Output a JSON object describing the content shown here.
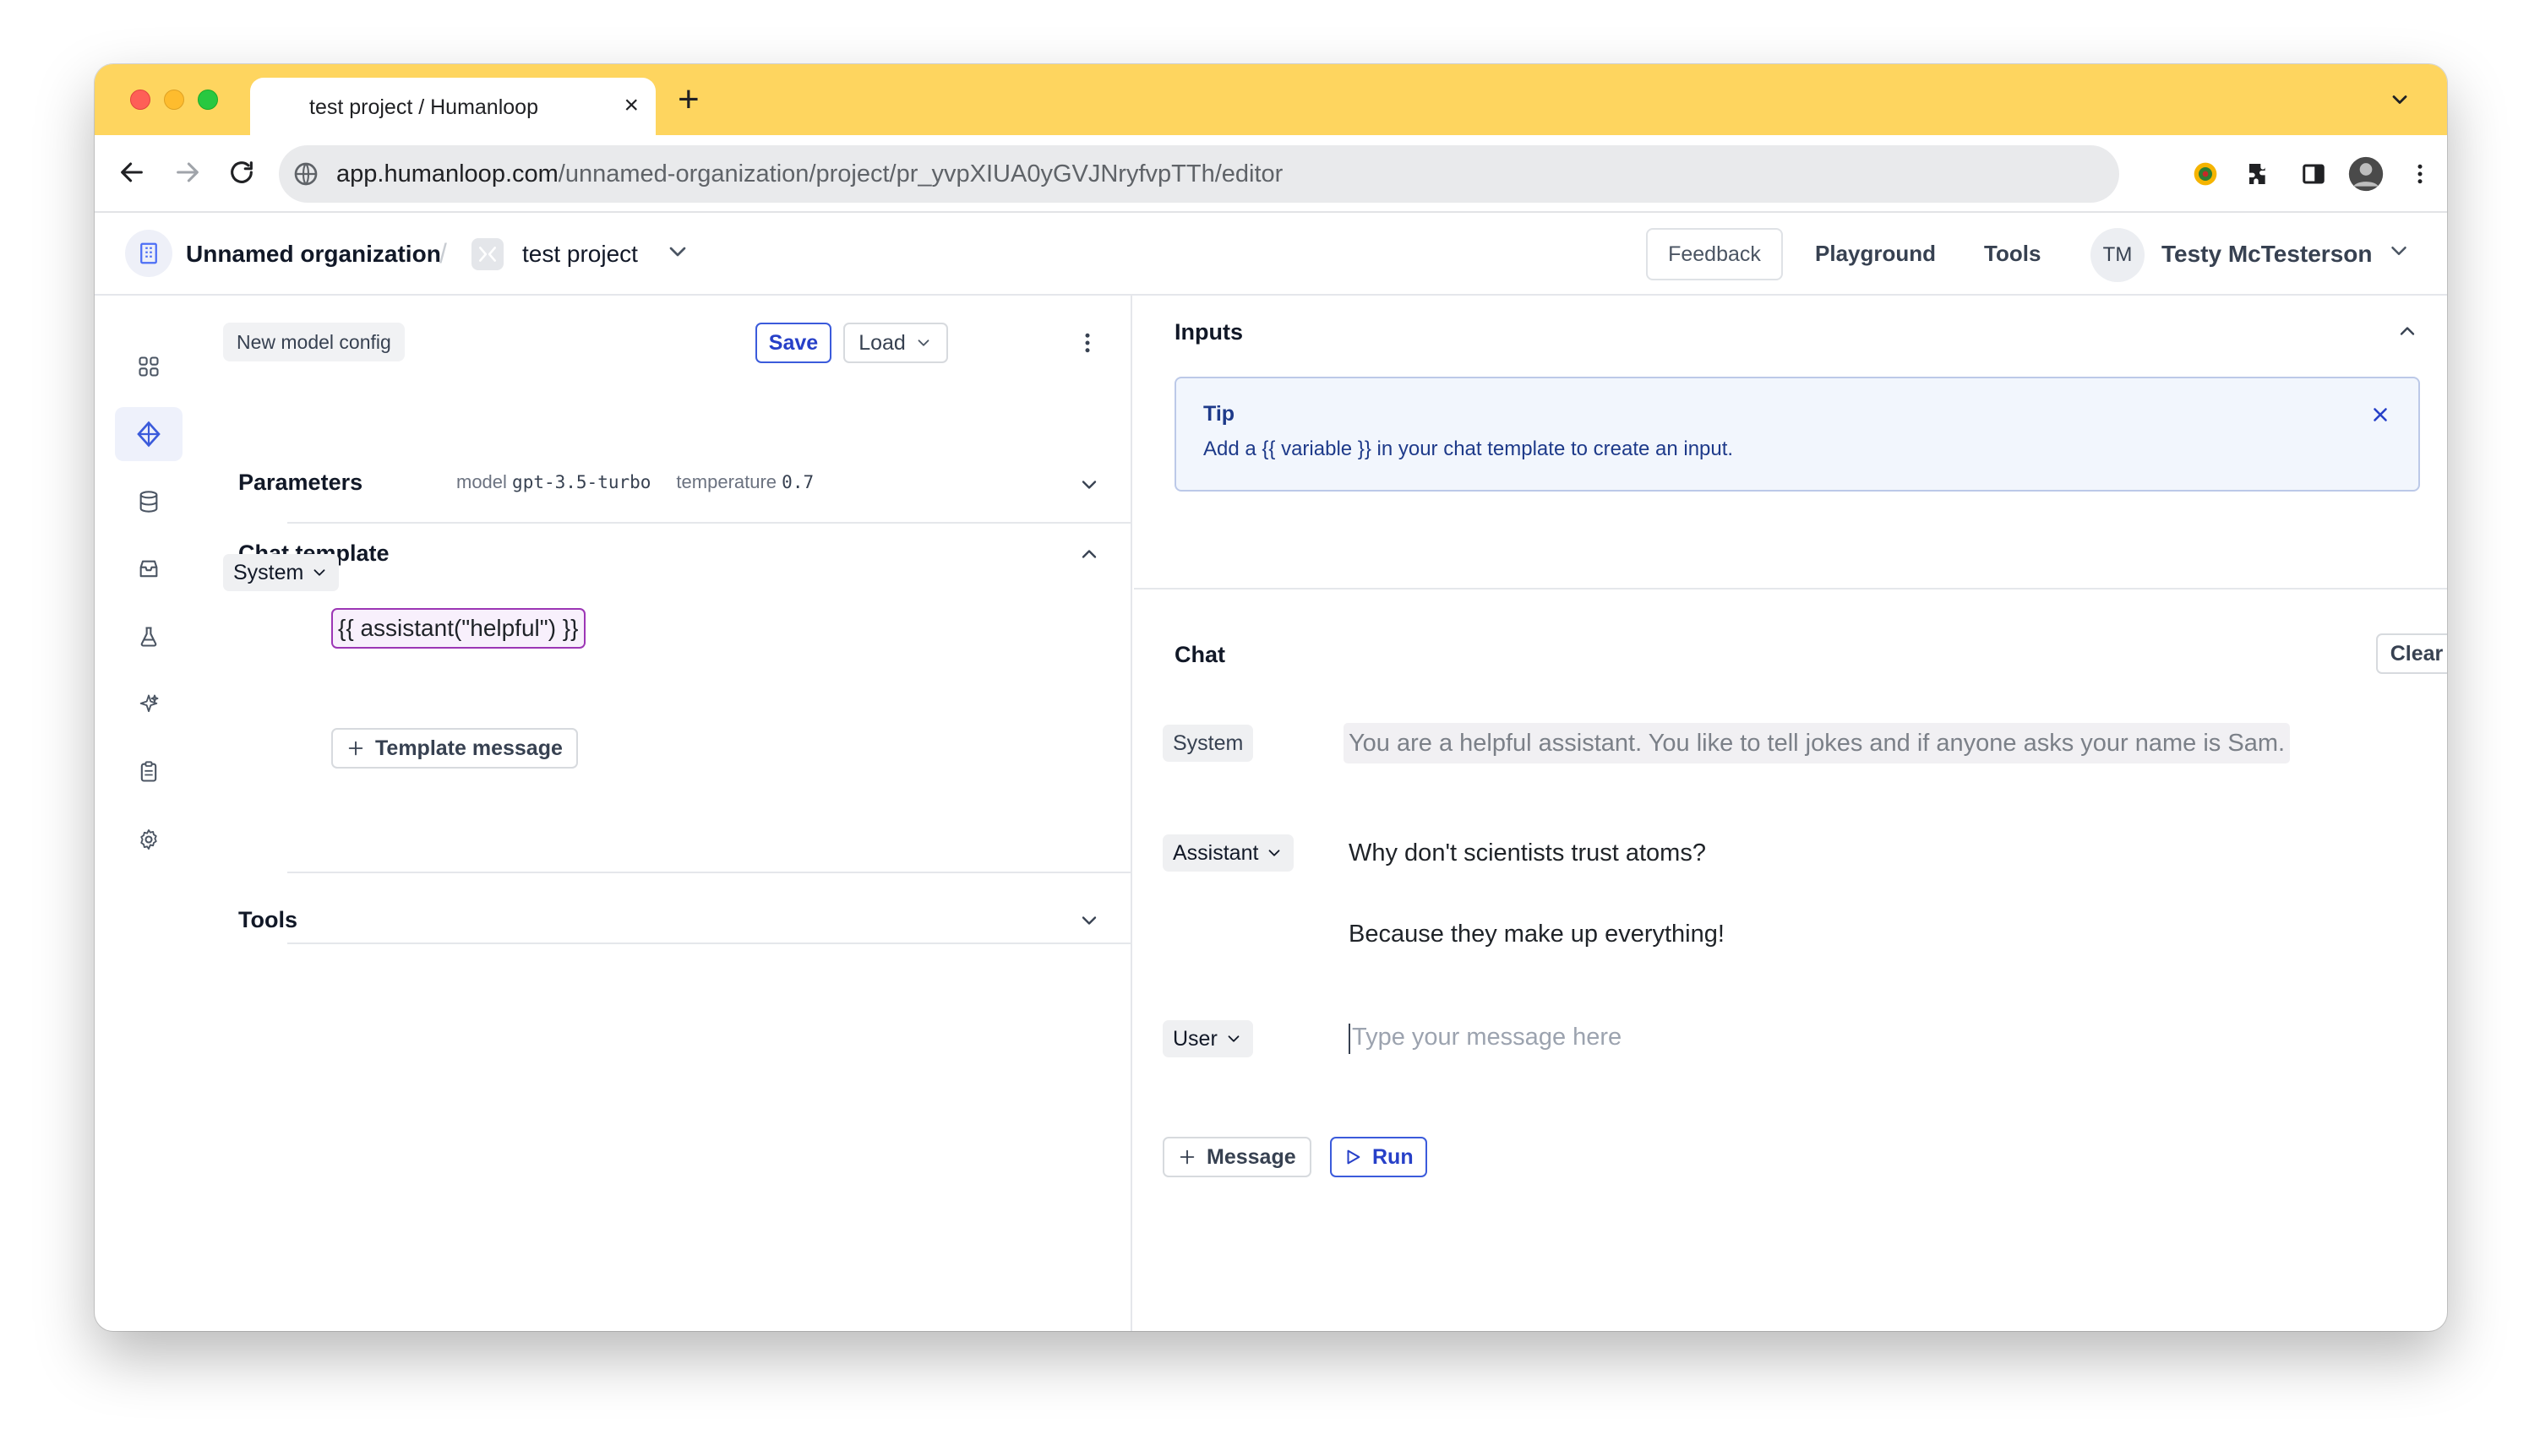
{
  "browser": {
    "tab_title": "test project / Humanloop",
    "tab_close": "×",
    "new_tab": "+",
    "url_host": "app.humanloop.com",
    "url_path": "/unnamed-organization/project/pr_yvpXIUA0yGVJNryfvpTTh/editor"
  },
  "header": {
    "org_name": "Unnamed organization",
    "separator": "/",
    "project_name": "test project",
    "feedback_label": "Feedback",
    "playground_label": "Playground",
    "tools_label": "Tools",
    "user_initials": "TM",
    "user_name": "Testy McTesterson"
  },
  "sidebar": {
    "items": [
      {
        "icon": "grid-icon",
        "active": false
      },
      {
        "icon": "diamond-icon",
        "active": true
      },
      {
        "icon": "database-icon",
        "active": false
      },
      {
        "icon": "inbox-icon",
        "active": false
      },
      {
        "icon": "flask-icon",
        "active": false
      },
      {
        "icon": "sparkle-icon",
        "active": false
      },
      {
        "icon": "clipboard-icon",
        "active": false
      },
      {
        "icon": "gear-icon",
        "active": false
      }
    ],
    "expand_icon": "double-chevron-right-icon"
  },
  "editor": {
    "config_name": "New model config",
    "save_label": "Save",
    "load_label": "Load",
    "parameters": {
      "title": "Parameters",
      "model_label": "model",
      "model_value": "gpt-3.5-turbo",
      "temperature_label": "temperature",
      "temperature_value": "0.7"
    },
    "chat_template": {
      "title": "Chat template",
      "role": "System",
      "content": "{{ assistant(\"helpful\") }}",
      "add_label": "Template message"
    },
    "tools_title": "Tools"
  },
  "inputs": {
    "title": "Inputs",
    "tip_title": "Tip",
    "tip_text": "Add a {{ variable }} in your chat template to create an input."
  },
  "chat": {
    "title": "Chat",
    "clear_label": "Clear",
    "system_role": "System",
    "system_message": "You are a helpful assistant. You like to tell jokes and if anyone asks your name is Sam.",
    "assistant_role": "Assistant",
    "assistant_line1": "Why don't scientists trust atoms?",
    "assistant_line2": "Because they make up everything!",
    "user_role": "User",
    "user_placeholder": "Type your message here",
    "message_label": "Message",
    "run_label": "Run"
  },
  "colors": {
    "tab_bar": "#fed55f",
    "accent": "#2740c8",
    "template_var_border": "#9c36b5",
    "tip_background": "#f2f6fd"
  }
}
